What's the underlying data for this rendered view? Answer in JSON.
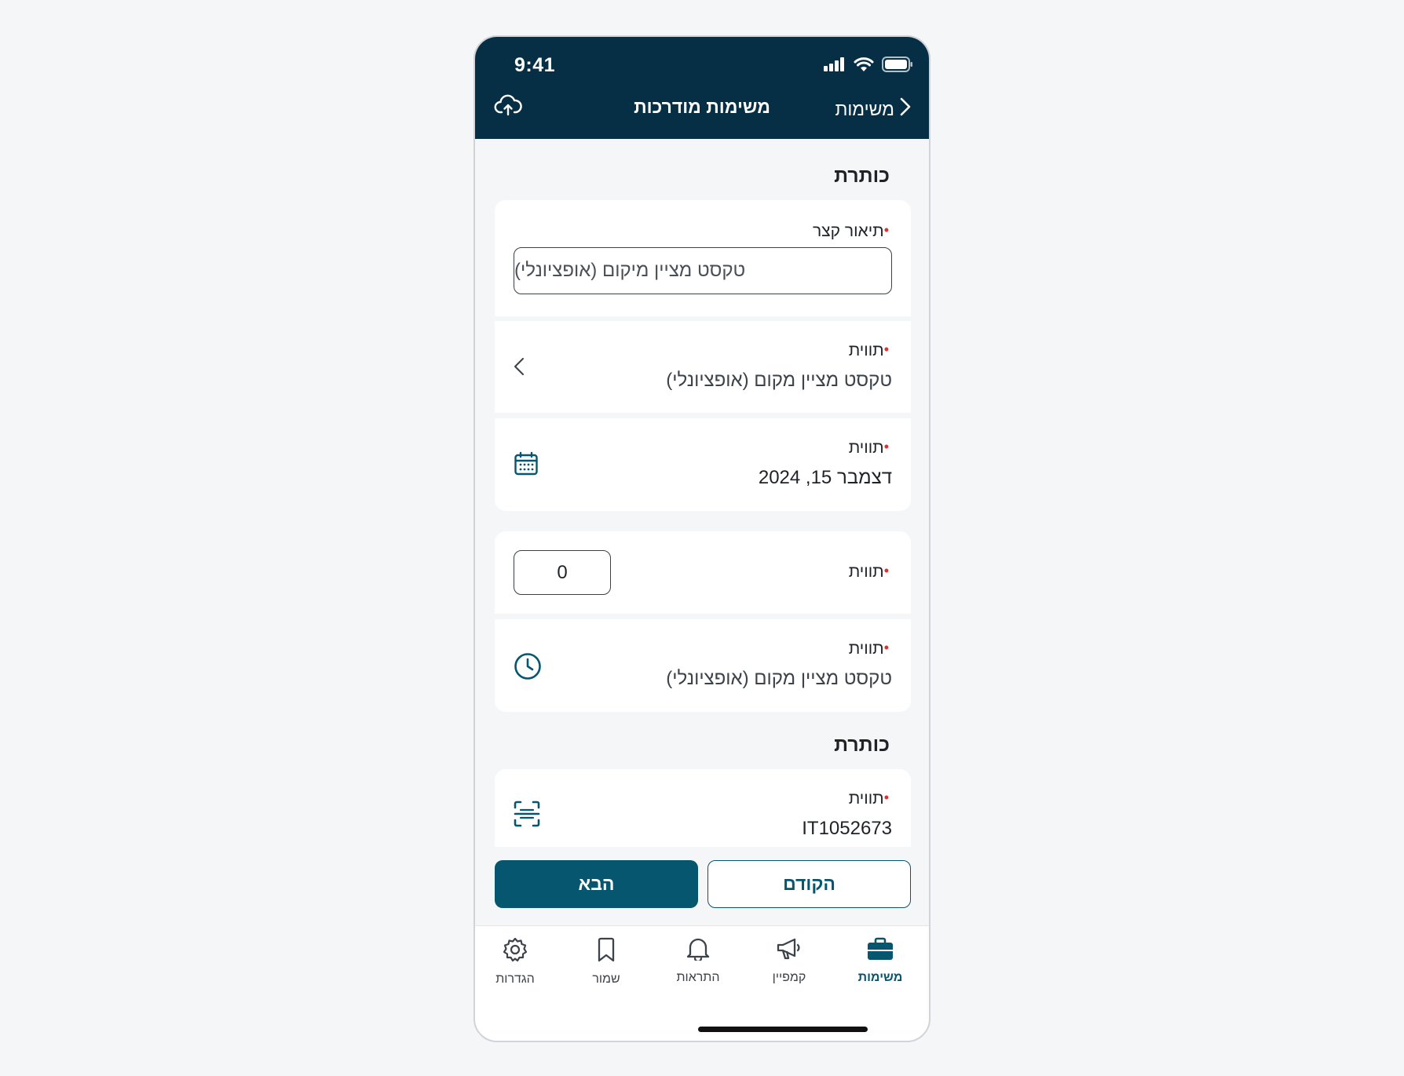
{
  "status_bar": {
    "time": "9:41"
  },
  "nav": {
    "back_label": "משימות",
    "title": "משימות מודרכות"
  },
  "sections": [
    {
      "title": "כותרת"
    },
    {
      "title": "כותרת"
    }
  ],
  "fields": {
    "short_description": {
      "label": "תיאור קצר",
      "placeholder": "טקסט מציין מיקום (אופציונלי)"
    },
    "select_field": {
      "label": "תווית",
      "value": "טקסט מציין מקום (אופציונלי)"
    },
    "date_field": {
      "label": "תווית",
      "value": "דצמבר 15, 2024"
    },
    "number_field": {
      "label": "תווית",
      "value": "0"
    },
    "time_field": {
      "label": "תווית",
      "value": "טקסט מציין מקום (אופציונלי)"
    },
    "scan_field": {
      "label": "תווית",
      "value": "IT1052673"
    }
  },
  "actions": {
    "next_label": "הבא",
    "prev_label": "הקודם"
  },
  "tabs": [
    {
      "label": "משימות",
      "icon": "briefcase-icon",
      "active": true
    },
    {
      "label": "קמפיין",
      "icon": "megaphone-icon",
      "active": false
    },
    {
      "label": "התראות",
      "icon": "bell-icon",
      "active": false
    },
    {
      "label": "שמור",
      "icon": "bookmark-icon",
      "active": false
    },
    {
      "label": "הגדרות",
      "icon": "gear-icon",
      "active": false
    }
  ],
  "colors": {
    "header_bg": "#062f45",
    "primary": "#06566f",
    "required": "#e0312f"
  }
}
